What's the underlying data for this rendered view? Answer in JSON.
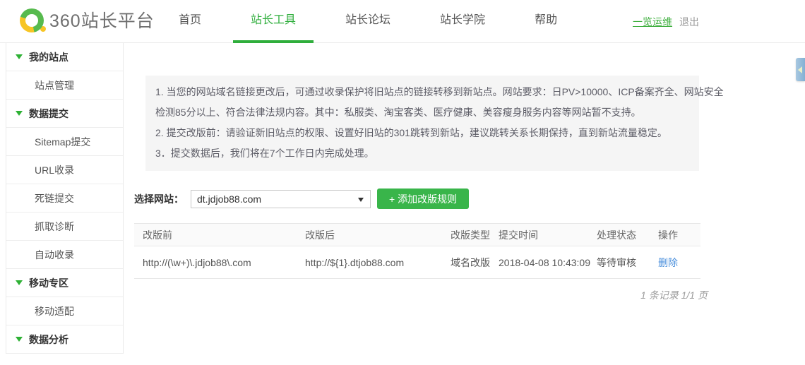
{
  "header": {
    "logo": {
      "text": "360站长平台"
    },
    "nav": [
      {
        "label": "首页",
        "active": false
      },
      {
        "label": "站长工具",
        "active": true
      },
      {
        "label": "站长论坛",
        "active": false
      },
      {
        "label": "站长学院",
        "active": false
      },
      {
        "label": "帮助",
        "active": false
      }
    ],
    "links": {
      "ops": "一览运维",
      "logout": "退出"
    }
  },
  "sidebar": {
    "sections": [
      {
        "title": "我的站点",
        "items": [
          "站点管理"
        ]
      },
      {
        "title": "数据提交",
        "items": [
          "Sitemap提交",
          "URL收录",
          "死链提交",
          "抓取诊断",
          "自动收录"
        ]
      },
      {
        "title": "移动专区",
        "items": [
          "移动适配"
        ]
      },
      {
        "title": "数据分析",
        "items": []
      }
    ]
  },
  "main": {
    "notice": {
      "lines": [
        "1. 当您的网站域名链接更改后，可通过收录保护将旧站点的链接转移到新站点。网站要求：日PV>10000、ICP备案齐全、网站安全",
        "检测85分以上、符合法律法规内容。其中：私服类、淘宝客类、医疗健康、美容瘦身服务内容等网站暂不支持。",
        "2. 提交改版前：请验证新旧站点的权限、设置好旧站的301跳转到新站，建议跳转关系长期保持，直到新站流量稳定。",
        "3．提交数据后，我们将在7个工作日内完成处理。"
      ]
    },
    "site_select": {
      "label": "选择网站：",
      "value": "dt.jdjob88.com"
    },
    "add_rule_button": "+ 添加改版规则",
    "table": {
      "headers": [
        "改版前",
        "改版后",
        "改版类型",
        "提交时间",
        "处理状态",
        "操作"
      ],
      "rows": [
        {
          "before": "http://(\\w+)\\.jdjob88\\.com",
          "after": "http://${1}.dtjob88.com",
          "type": "域名改版",
          "time": "2018-04-08 10:43:09",
          "status": "等待审核",
          "action": "删除"
        }
      ]
    },
    "pagination": "1 条记录 1/1 页"
  },
  "colors": {
    "brand_green": "#39b54a",
    "nav_active_green": "#2fae3c",
    "logo_yellow": "#f7c524",
    "link_blue": "#4a8fdc",
    "notice_bg": "#f5f5f5",
    "side_tab_blue": "#84b0d3"
  }
}
